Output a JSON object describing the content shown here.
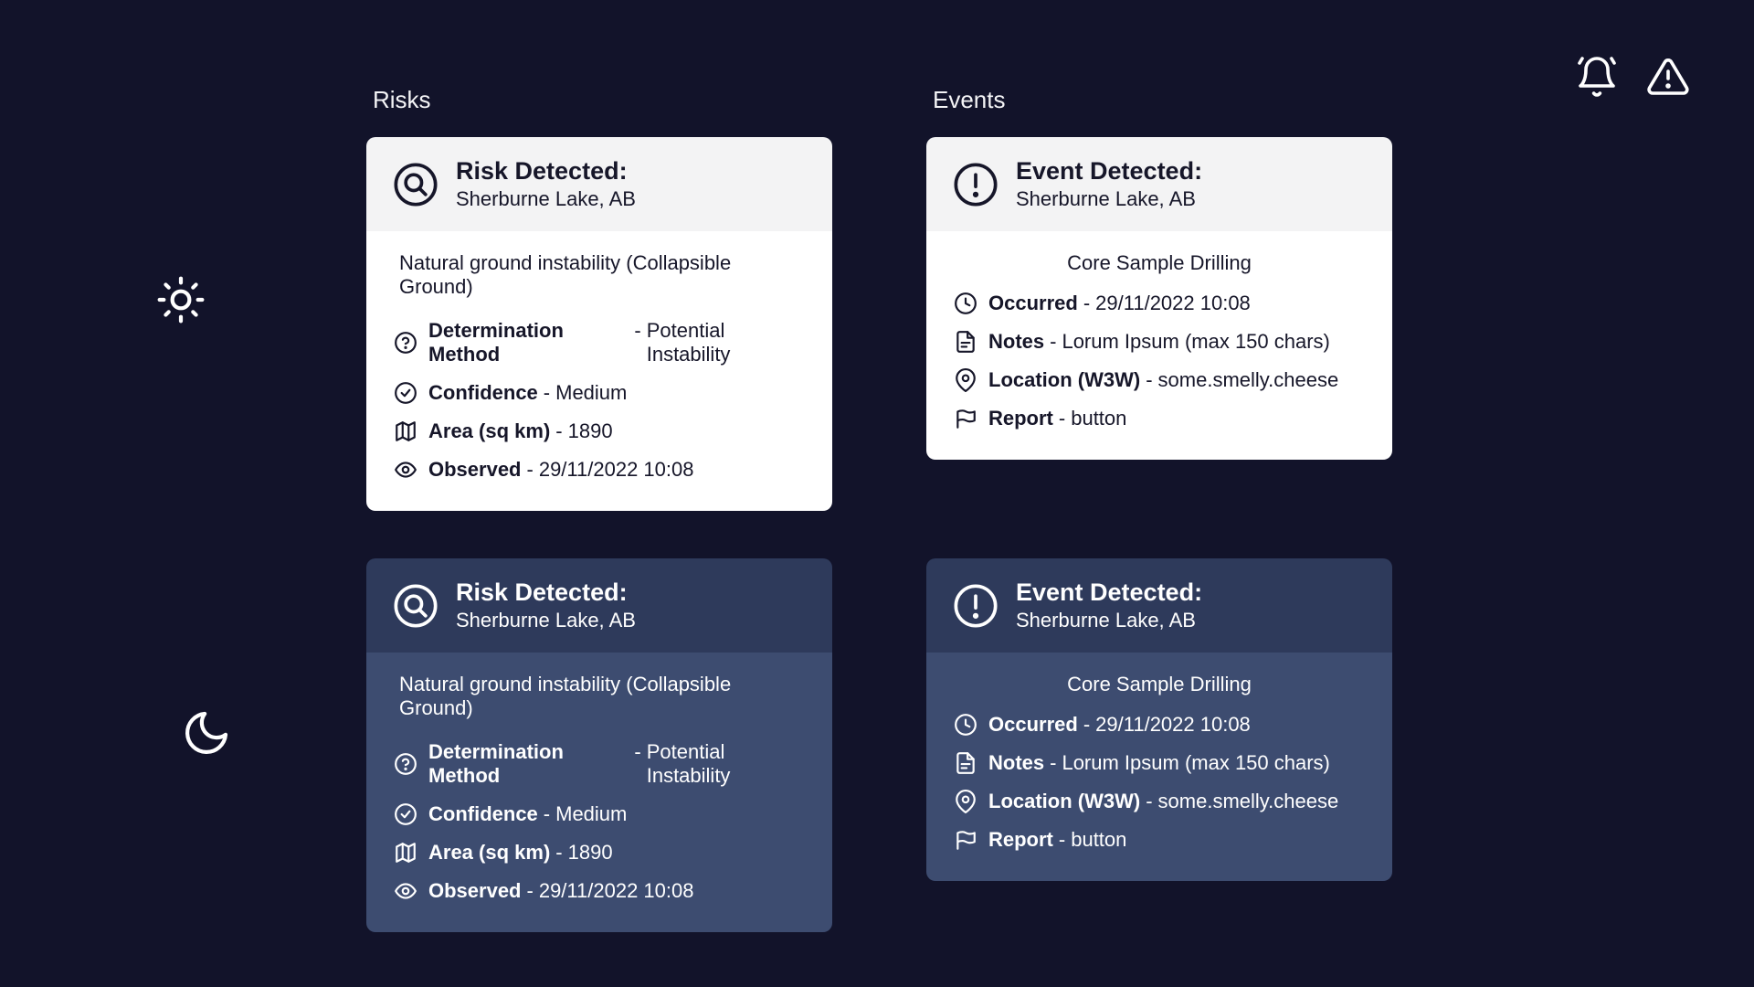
{
  "sections": {
    "risks": "Risks",
    "events": "Events"
  },
  "risk": {
    "title": "Risk Detected:",
    "location": "Sherburne Lake, AB",
    "description": "Natural ground instability (Collapsible Ground)",
    "rows": {
      "determination": {
        "label": "Determination Method",
        "value": "Potential Instability"
      },
      "confidence": {
        "label": "Confidence",
        "value": "Medium"
      },
      "area": {
        "label": "Area (sq km)",
        "value": "1890"
      },
      "observed": {
        "label": "Observed",
        "value": "29/11/2022 10:08"
      }
    }
  },
  "event": {
    "title": "Event Detected:",
    "location": "Sherburne Lake, AB",
    "description": "Core Sample Drilling",
    "rows": {
      "occurred": {
        "label": "Occurred",
        "value": "29/11/2022 10:08"
      },
      "notes": {
        "label": "Notes",
        "value": "Lorum Ipsum (max 150 chars)"
      },
      "locw3w": {
        "label": "Location (W3W)",
        "value": "some.smelly.cheese"
      },
      "report": {
        "label": "Report",
        "value": "button"
      }
    }
  }
}
